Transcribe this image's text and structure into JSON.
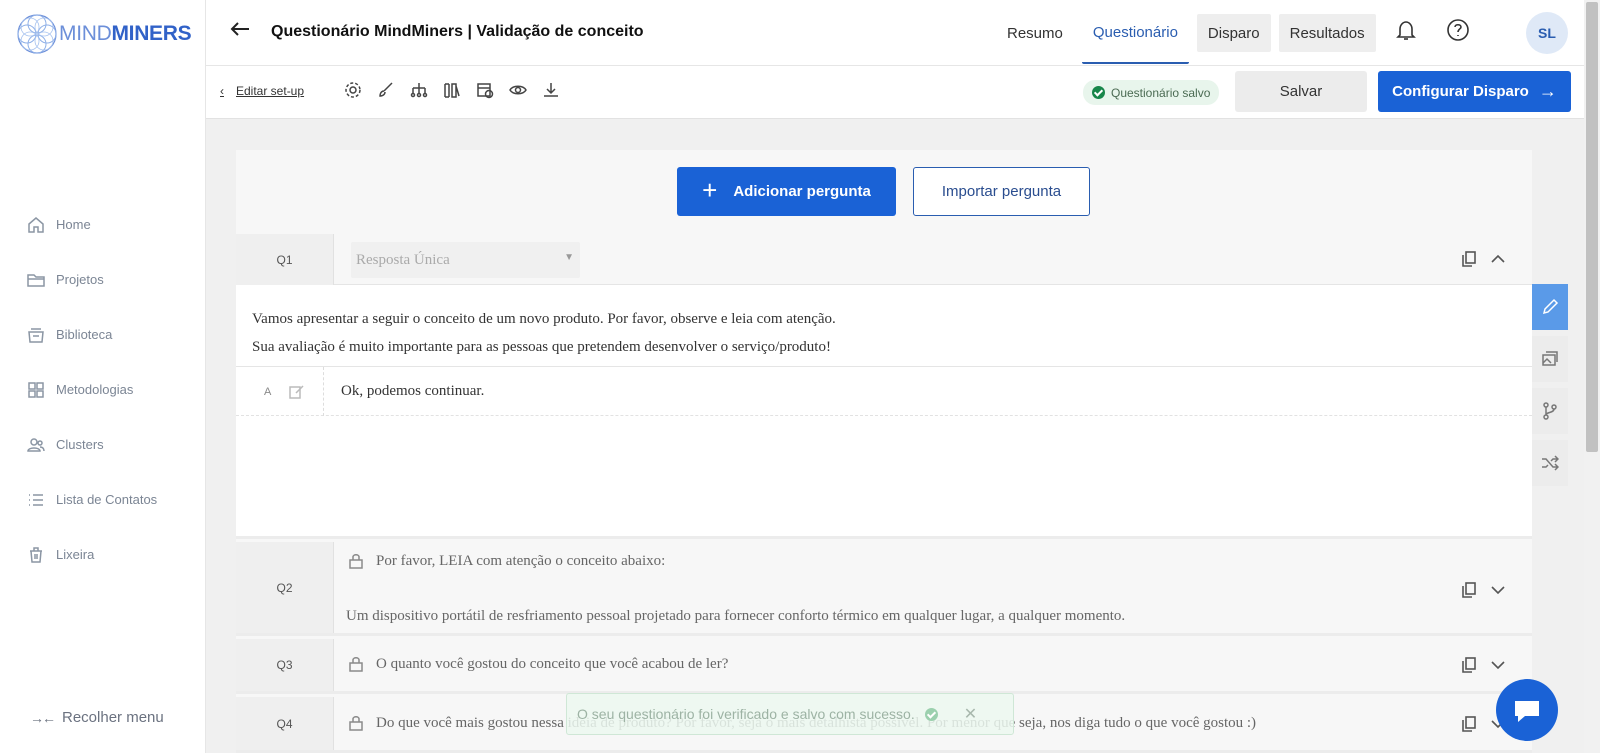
{
  "logo": {
    "light": "MIND",
    "bold": "MINERS"
  },
  "sidebar": {
    "items": [
      {
        "label": "Home",
        "icon": "home-icon"
      },
      {
        "label": "Projetos",
        "icon": "folder-icon"
      },
      {
        "label": "Biblioteca",
        "icon": "library-icon"
      },
      {
        "label": "Metodologias",
        "icon": "grid-icon"
      },
      {
        "label": "Clusters",
        "icon": "users-icon"
      },
      {
        "label": "Lista de Contatos",
        "icon": "list-icon"
      },
      {
        "label": "Lixeira",
        "icon": "trash-icon"
      }
    ],
    "collapse_label": "Recolher menu"
  },
  "header": {
    "title": "Questionário MindMiners | Validação de conceito",
    "tabs": [
      "Resumo",
      "Questionário",
      "Disparo",
      "Resultados"
    ],
    "active_tab": "Questionário",
    "avatar_initials": "SL"
  },
  "toolbar": {
    "edit_setup": "Editar set-up",
    "saved_status": "Questionário salvo",
    "save_label": "Salvar",
    "configure_label": "Configurar Disparo"
  },
  "content": {
    "add_question": "Adicionar pergunta",
    "import_question": "Importar pergunta"
  },
  "questions": [
    {
      "number": "Q1",
      "type": "Resposta Única",
      "text_lines": [
        "Vamos apresentar a seguir o conceito de um novo produto. Por favor, observe e leia com atenção.",
        "Sua avaliação é muito importante para as pessoas que pretendem desenvolver o serviço/produto!"
      ],
      "options": [
        {
          "letter": "A",
          "text": "Ok, podemos continuar."
        }
      ]
    },
    {
      "number": "Q2",
      "text": "Por favor, LEIA com atenção o conceito abaixo:",
      "text2": "Um dispositivo portátil de resfriamento pessoal projetado para fornecer conforto térmico em qualquer lugar, a qualquer momento."
    },
    {
      "number": "Q3",
      "text": "O quanto você gostou do conceito que você acabou de ler?"
    },
    {
      "number": "Q4",
      "text": "Do que você mais gostou nessa ideia de produto? Por favor, seja o mais detalhista possível. Por menor que seja, nos diga tudo o que você gostou :)"
    }
  ],
  "toast": {
    "message": "O seu questionário foi verificado e salvo com sucesso."
  },
  "colors": {
    "primary": "#1a62d6",
    "success": "#18864a"
  }
}
